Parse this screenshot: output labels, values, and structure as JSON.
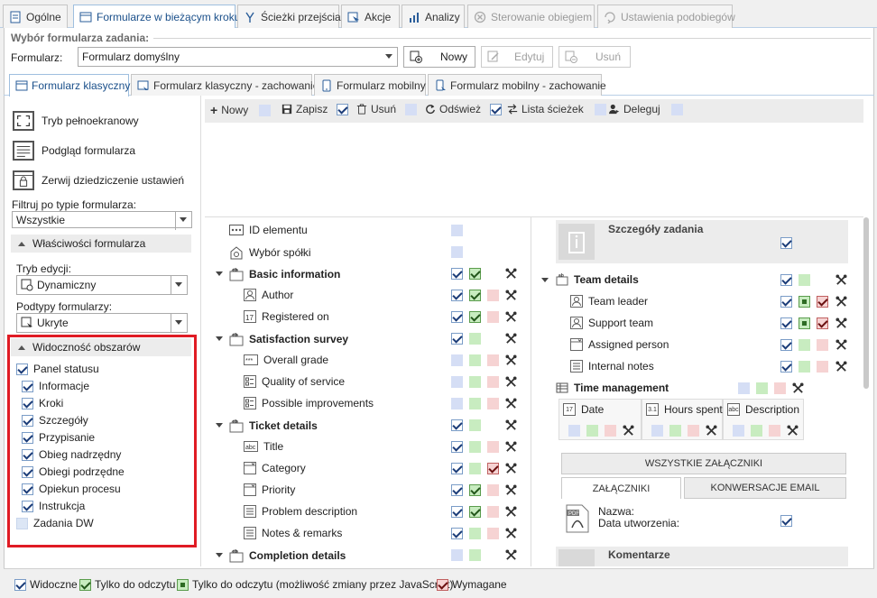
{
  "top_tabs": [
    {
      "label": "Ogólne",
      "icon": "document-icon",
      "state": "normal"
    },
    {
      "label": "Formularze w bieżącym kroku",
      "icon": "form-icon",
      "state": "active"
    },
    {
      "label": "Ścieżki przejścia",
      "icon": "path-icon",
      "state": "normal"
    },
    {
      "label": "Akcje",
      "icon": "action-icon",
      "state": "normal"
    },
    {
      "label": "Analizy",
      "icon": "chart-icon",
      "state": "normal"
    },
    {
      "label": "Sterowanie obiegiem",
      "icon": "flow-control-icon",
      "state": "disabled"
    },
    {
      "label": "Ustawienia podobiegów",
      "icon": "subflow-icon",
      "state": "disabled"
    }
  ],
  "form_select": {
    "section_title": "Wybór formularza zadania:",
    "label": "Formularz:",
    "value": "Formularz domyślny",
    "new_button": "Nowy",
    "edit_button": "Edytuj",
    "delete_button": "Usuń"
  },
  "sub_tabs": [
    {
      "label": "Formularz klasyczny",
      "state": "active"
    },
    {
      "label": "Formularz klasyczny - zachowanie",
      "state": "normal"
    },
    {
      "label": "Formularz mobilny",
      "state": "normal"
    },
    {
      "label": "Formularz mobilny - zachowanie",
      "state": "normal"
    }
  ],
  "left_panel": {
    "actions": [
      {
        "label": "Tryb pełnoekranowy",
        "icon": "fullscreen-icon"
      },
      {
        "label": "Podgląd formularza",
        "icon": "preview-icon"
      },
      {
        "label": "Zerwij dziedziczenie ustawień",
        "icon": "lock-icon"
      }
    ],
    "filter_label": "Filtruj po typie formularza:",
    "filter_value": "Wszystkie",
    "properties_header": "Właściwości formularza",
    "edit_mode_label": "Tryb edycji:",
    "edit_mode_value": "Dynamiczny",
    "subtypes_label": "Podtypy formularzy:",
    "subtypes_value": "Ukryte",
    "visibility_header": "Widoczność obszarów",
    "visibility_items": [
      {
        "label": "Panel statusu",
        "checked": true,
        "indent": 0
      },
      {
        "label": "Informacje",
        "checked": true,
        "indent": 1
      },
      {
        "label": "Kroki",
        "checked": true,
        "indent": 1
      },
      {
        "label": "Szczegóły",
        "checked": true,
        "indent": 1
      },
      {
        "label": "Przypisanie",
        "checked": true,
        "indent": 1
      },
      {
        "label": "Obieg nadrzędny",
        "checked": true,
        "indent": 1
      },
      {
        "label": "Obiegi podrzędne",
        "checked": true,
        "indent": 1
      },
      {
        "label": "Opiekun procesu",
        "checked": true,
        "indent": 1
      },
      {
        "label": "Instrukcja",
        "checked": true,
        "indent": 1
      },
      {
        "label": "Zadania DW",
        "checked": false,
        "indent": 0
      }
    ]
  },
  "toolbar": {
    "new_label": "Nowy",
    "save_label": "Zapisz",
    "delete_label": "Usuń",
    "refresh_label": "Odśwież",
    "paths_label": "Lista ścieżek",
    "delegate_label": "Deleguj"
  },
  "fields": [
    {
      "label": "ID elementu",
      "indent": 1,
      "bold": false,
      "icon": "id-icon",
      "cells": [
        "b"
      ],
      "tools": false
    },
    {
      "label": "Wybór spółki",
      "indent": 1,
      "bold": false,
      "icon": "company-icon",
      "cells": [
        "b"
      ],
      "tools": false
    },
    {
      "label": "Basic information",
      "indent": 0,
      "bold": true,
      "icon": "group-icon",
      "cells": [
        "vb",
        "vg"
      ],
      "tools": true
    },
    {
      "label": "Author",
      "indent": 2,
      "bold": false,
      "icon": "user-icon",
      "cells": [
        "vb",
        "vg",
        "r"
      ],
      "tools": true
    },
    {
      "label": "Registered on",
      "indent": 2,
      "bold": false,
      "icon": "date-icon",
      "cells": [
        "vb",
        "vg",
        "r"
      ],
      "tools": true
    },
    {
      "label": "Satisfaction survey",
      "indent": 0,
      "bold": true,
      "icon": "group-icon",
      "cells": [
        "vb",
        "g"
      ],
      "tools": true
    },
    {
      "label": "Overall grade",
      "indent": 2,
      "bold": false,
      "icon": "rating-icon",
      "cells": [
        "b",
        "g",
        "r"
      ],
      "tools": true
    },
    {
      "label": "Quality of service",
      "indent": 2,
      "bold": false,
      "icon": "choice-icon",
      "cells": [
        "b",
        "g",
        "r"
      ],
      "tools": true
    },
    {
      "label": "Possible improvements",
      "indent": 2,
      "bold": false,
      "icon": "choice-icon",
      "cells": [
        "b",
        "g",
        "r"
      ],
      "tools": true
    },
    {
      "label": "Ticket details",
      "indent": 0,
      "bold": true,
      "icon": "group-icon",
      "cells": [
        "vb",
        "g"
      ],
      "tools": true
    },
    {
      "label": "Title",
      "indent": 2,
      "bold": false,
      "icon": "text-icon",
      "cells": [
        "vb",
        "g",
        "r"
      ],
      "tools": true
    },
    {
      "label": "Category",
      "indent": 2,
      "bold": false,
      "icon": "dropdown-icon",
      "cells": [
        "vb",
        "g",
        "vr"
      ],
      "tools": true
    },
    {
      "label": "Priority",
      "indent": 2,
      "bold": false,
      "icon": "dropdown-icon",
      "cells": [
        "vb",
        "vg",
        "r"
      ],
      "tools": true
    },
    {
      "label": "Problem description",
      "indent": 2,
      "bold": false,
      "icon": "textarea-icon",
      "cells": [
        "vb",
        "vg",
        "r"
      ],
      "tools": true
    },
    {
      "label": "Notes & remarks",
      "indent": 2,
      "bold": false,
      "icon": "textarea-icon",
      "cells": [
        "vb",
        "g",
        "r"
      ],
      "tools": true
    },
    {
      "label": "Completion details",
      "indent": 0,
      "bold": true,
      "icon": "group-icon",
      "cells": [
        "b",
        "g"
      ],
      "tools": true
    }
  ],
  "preview": {
    "task_details_title": "Szczegóły zadania",
    "team_details_title": "Team details",
    "team_fields": [
      {
        "label": "Team leader",
        "icon": "user-icon",
        "cells": [
          "vb",
          "gd",
          "vr"
        ]
      },
      {
        "label": "Support team",
        "icon": "user-icon",
        "cells": [
          "vb",
          "gd",
          "vr"
        ]
      },
      {
        "label": "Assigned person",
        "icon": "dropdown-icon",
        "cells": [
          "vb",
          "g",
          "r"
        ]
      },
      {
        "label": "Internal notes",
        "icon": "textarea-icon",
        "cells": [
          "vb",
          "g",
          "r"
        ]
      }
    ],
    "time_management_title": "Time management",
    "time_columns": [
      {
        "label": "Date",
        "icon_text": "17"
      },
      {
        "label": "Hours spent",
        "icon_text": "3.1"
      },
      {
        "label": "Description",
        "icon_text": "abc"
      }
    ],
    "all_attachments": "WSZYSTKIE ZAŁĄCZNIKI",
    "attachments_tab": "ZAŁĄCZNIKI",
    "email_tab": "KONWERSACJE EMAIL",
    "attachment_name_label": "Nazwa:",
    "attachment_date_label": "Data utworzenia:",
    "comments_title": "Komentarze"
  },
  "legend": [
    {
      "label": "Widoczne",
      "type": "vb"
    },
    {
      "label": "Tylko do odczytu",
      "type": "vg"
    },
    {
      "label": "Tylko do odczytu (możliwość zmiany przez JavaScript)",
      "type": "gd"
    },
    {
      "label": "Wymagane",
      "type": "vr"
    }
  ]
}
